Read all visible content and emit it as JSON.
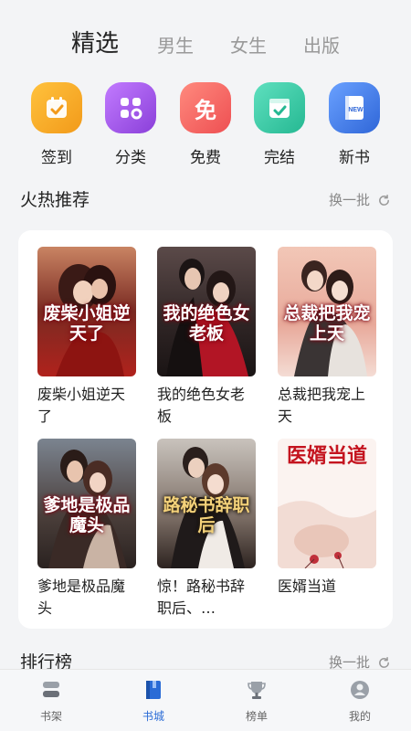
{
  "top_tabs": [
    "精选",
    "男生",
    "女生",
    "出版"
  ],
  "quick_entries": [
    {
      "label": "签到",
      "icon": "calendar-check-icon",
      "color": "#f5a623"
    },
    {
      "label": "分类",
      "icon": "grid-category-icon",
      "color": "#a457e6"
    },
    {
      "label": "免费",
      "icon": "free-badge-icon",
      "color": "#f2625f"
    },
    {
      "label": "完结",
      "icon": "checkbox-done-icon",
      "color": "#34c4a3"
    },
    {
      "label": "新书",
      "icon": "new-book-icon",
      "color": "#3f7ee8"
    }
  ],
  "hot_section": {
    "title": "火热推荐",
    "refresh_label": "换一批"
  },
  "books": [
    {
      "title": "废柴小姐逆天了",
      "cover_text": "废柴小姐逆天了"
    },
    {
      "title": "我的绝色女老板",
      "cover_text": "我的绝色女老板"
    },
    {
      "title": "总裁把我宠上天",
      "cover_text": "总裁把我宠上天"
    },
    {
      "title": "爹地是极品魔头",
      "cover_text": "爹地是极品魔头"
    },
    {
      "title": "惊！路秘书辞职后、…",
      "cover_text": "路秘书辞职后"
    },
    {
      "title": "医婿当道",
      "cover_text": "医婿当道"
    }
  ],
  "rank_section": {
    "title": "排行榜",
    "refresh_label": "换一批"
  },
  "bottom_nav": [
    {
      "label": "书架",
      "icon": "bookshelf-icon"
    },
    {
      "label": "书城",
      "icon": "bookstore-icon"
    },
    {
      "label": "榜单",
      "icon": "trophy-icon"
    },
    {
      "label": "我的",
      "icon": "profile-icon"
    }
  ],
  "colors": {
    "accent": "#2a6bd6",
    "background": "#f3f4f6"
  }
}
